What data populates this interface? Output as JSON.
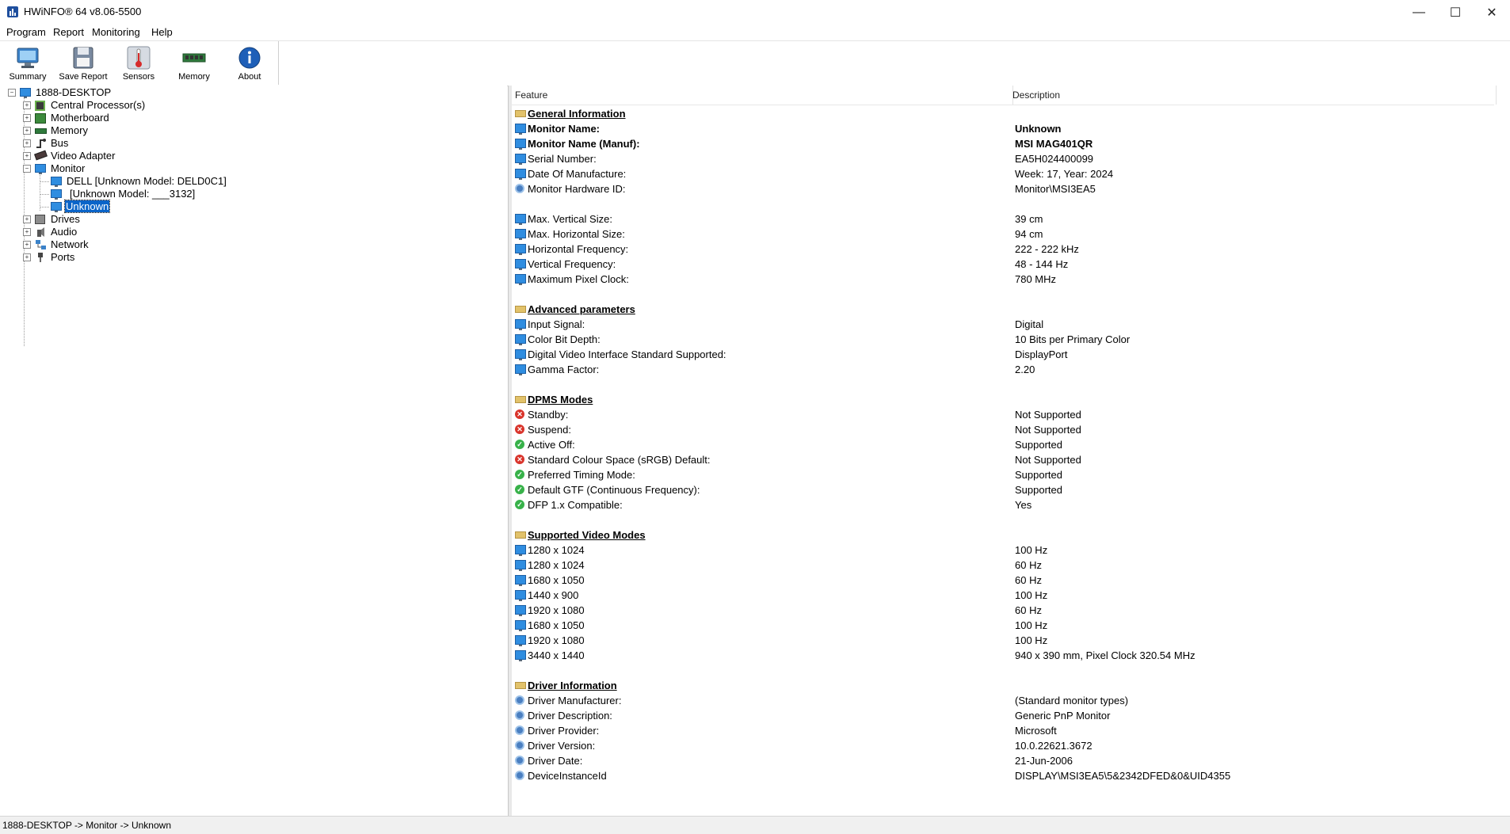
{
  "window": {
    "title": "HWiNFO® 64 v8.06-5500",
    "minimize": "—",
    "maximize": "☐",
    "close": "✕"
  },
  "menu": [
    "Program",
    "Report",
    "Monitoring",
    "Help"
  ],
  "toolbar": [
    {
      "label": "Summary",
      "icon": "monitor-icon"
    },
    {
      "label": "Save Report",
      "icon": "floppy-icon"
    },
    {
      "label": "Sensors",
      "icon": "thermometer-icon"
    },
    {
      "label": "Memory",
      "icon": "memory-chip-icon"
    },
    {
      "label": "About",
      "icon": "info-icon"
    }
  ],
  "tree": {
    "root": "1888-DESKTOP",
    "items": [
      {
        "label": "Central Processor(s)",
        "icon": "cpu-icon",
        "expander": "+"
      },
      {
        "label": "Motherboard",
        "icon": "motherboard-icon",
        "expander": "+"
      },
      {
        "label": "Memory",
        "icon": "memory-icon",
        "expander": "+"
      },
      {
        "label": "Bus",
        "icon": "bus-icon",
        "expander": "+"
      },
      {
        "label": "Video Adapter",
        "icon": "video-adapter-icon",
        "expander": "+"
      },
      {
        "label": "Monitor",
        "icon": "monitor-icon",
        "expander": "−"
      },
      {
        "label": "Drives",
        "icon": "drives-icon",
        "expander": "+"
      },
      {
        "label": "Audio",
        "icon": "audio-icon",
        "expander": "+"
      },
      {
        "label": "Network",
        "icon": "network-icon",
        "expander": "+"
      },
      {
        "label": "Ports",
        "icon": "ports-icon",
        "expander": "+"
      }
    ],
    "monitor_children": [
      "DELL [Unknown Model: DELD0C1]",
      "[Unknown Model: ___3132]",
      "Unknown"
    ]
  },
  "details": {
    "col_feature": "Feature",
    "col_description": "Description",
    "rows": [
      {
        "type": "section",
        "feature": "General Information",
        "icon": "folder"
      },
      {
        "type": "item",
        "feature": "Monitor Name:",
        "desc": "Unknown",
        "icon": "monitor",
        "bold": true
      },
      {
        "type": "item",
        "feature": "Monitor Name (Manuf):",
        "desc": "MSI MAG401QR",
        "icon": "monitor",
        "bold": true
      },
      {
        "type": "item",
        "feature": "Serial Number:",
        "desc": "EA5H024400099",
        "icon": "monitor"
      },
      {
        "type": "item",
        "feature": "Date Of Manufacture:",
        "desc": "Week: 17, Year: 2024",
        "icon": "monitor"
      },
      {
        "type": "item",
        "feature": "Monitor Hardware ID:",
        "desc": "Monitor\\MSI3EA5",
        "icon": "gear"
      },
      {
        "type": "blank"
      },
      {
        "type": "item",
        "feature": "Max. Vertical Size:",
        "desc": "39 cm",
        "icon": "monitor"
      },
      {
        "type": "item",
        "feature": "Max. Horizontal Size:",
        "desc": "94 cm",
        "icon": "monitor"
      },
      {
        "type": "item",
        "feature": "Horizontal Frequency:",
        "desc": "222 - 222 kHz",
        "icon": "monitor"
      },
      {
        "type": "item",
        "feature": "Vertical Frequency:",
        "desc": "48 - 144 Hz",
        "icon": "monitor"
      },
      {
        "type": "item",
        "feature": "Maximum Pixel Clock:",
        "desc": "780 MHz",
        "icon": "monitor"
      },
      {
        "type": "blank"
      },
      {
        "type": "section",
        "feature": "Advanced parameters",
        "icon": "folder"
      },
      {
        "type": "item",
        "feature": "Input Signal:",
        "desc": "Digital",
        "icon": "monitor"
      },
      {
        "type": "item",
        "feature": "Color Bit Depth:",
        "desc": "10 Bits per Primary Color",
        "icon": "monitor"
      },
      {
        "type": "item",
        "feature": "Digital Video Interface Standard Supported:",
        "desc": "DisplayPort",
        "icon": "monitor"
      },
      {
        "type": "item",
        "feature": "Gamma Factor:",
        "desc": "2.20",
        "icon": "monitor"
      },
      {
        "type": "blank"
      },
      {
        "type": "section",
        "feature": "DPMS Modes",
        "icon": "folder"
      },
      {
        "type": "item",
        "feature": "Standby:",
        "desc": "Not Supported",
        "icon": "x"
      },
      {
        "type": "item",
        "feature": "Suspend:",
        "desc": "Not Supported",
        "icon": "x"
      },
      {
        "type": "item",
        "feature": "Active Off:",
        "desc": "Supported",
        "icon": "ok"
      },
      {
        "type": "item",
        "feature": "Standard Colour Space (sRGB) Default:",
        "desc": "Not Supported",
        "icon": "x"
      },
      {
        "type": "item",
        "feature": "Preferred Timing Mode:",
        "desc": "Supported",
        "icon": "ok"
      },
      {
        "type": "item",
        "feature": "Default GTF (Continuous Frequency):",
        "desc": "Supported",
        "icon": "ok"
      },
      {
        "type": "item",
        "feature": "DFP 1.x Compatible:",
        "desc": "Yes",
        "icon": "ok"
      },
      {
        "type": "blank"
      },
      {
        "type": "section",
        "feature": "Supported Video Modes",
        "icon": "folder"
      },
      {
        "type": "item",
        "feature": "1280 x 1024",
        "desc": "100 Hz",
        "icon": "monitor"
      },
      {
        "type": "item",
        "feature": "1280 x 1024",
        "desc": "60 Hz",
        "icon": "monitor"
      },
      {
        "type": "item",
        "feature": "1680 x 1050",
        "desc": "60 Hz",
        "icon": "monitor"
      },
      {
        "type": "item",
        "feature": "1440 x 900",
        "desc": "100 Hz",
        "icon": "monitor"
      },
      {
        "type": "item",
        "feature": "1920 x 1080",
        "desc": "60 Hz",
        "icon": "monitor"
      },
      {
        "type": "item",
        "feature": "1680 x 1050",
        "desc": "100 Hz",
        "icon": "monitor"
      },
      {
        "type": "item",
        "feature": "1920 x 1080",
        "desc": "100 Hz",
        "icon": "monitor"
      },
      {
        "type": "item",
        "feature": "3440 x 1440",
        "desc": "940 x 390 mm, Pixel Clock 320.54 MHz",
        "icon": "monitor"
      },
      {
        "type": "blank"
      },
      {
        "type": "section",
        "feature": "Driver Information",
        "icon": "folder"
      },
      {
        "type": "item",
        "feature": "Driver Manufacturer:",
        "desc": "(Standard monitor types)",
        "icon": "gear"
      },
      {
        "type": "item",
        "feature": "Driver Description:",
        "desc": "Generic PnP Monitor",
        "icon": "gear"
      },
      {
        "type": "item",
        "feature": "Driver Provider:",
        "desc": "Microsoft",
        "icon": "gear"
      },
      {
        "type": "item",
        "feature": "Driver Version:",
        "desc": "10.0.22621.3672",
        "icon": "gear"
      },
      {
        "type": "item",
        "feature": "Driver Date:",
        "desc": "21-Jun-2006",
        "icon": "gear"
      },
      {
        "type": "item",
        "feature": "DeviceInstanceId",
        "desc": "DISPLAY\\MSI3EA5\\5&2342DFED&0&UID4355",
        "icon": "gear"
      }
    ]
  },
  "status": "1888-DESKTOP -> Monitor -> Unknown",
  "colors": {
    "selection": "#0a64c8",
    "monitor_icon": "#2f8de0",
    "error": "#d9342b",
    "ok": "#38b24a"
  }
}
